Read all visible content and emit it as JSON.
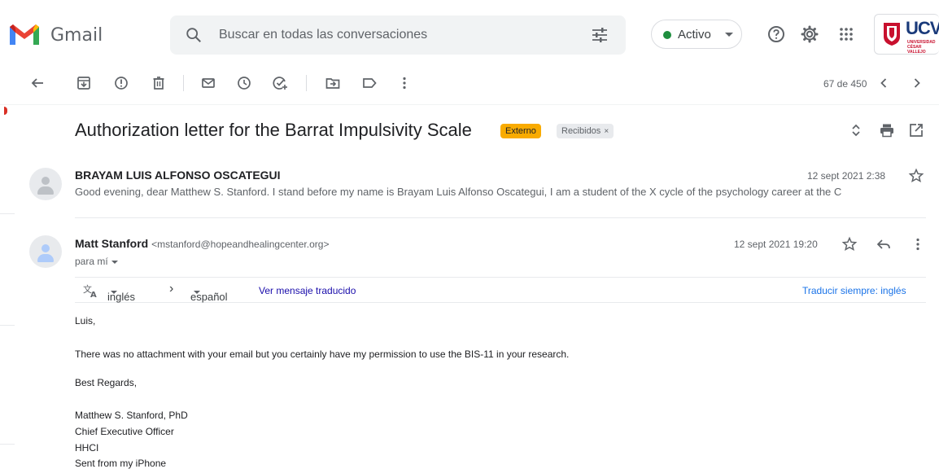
{
  "header": {
    "app_name": "Gmail",
    "search_placeholder": "Buscar en todas las conversaciones",
    "status_label": "Activo",
    "org_logo": {
      "text": "UCV",
      "subtitle_line1": "UNIVERSIDAD",
      "subtitle_line2": "CÉSAR VALLEJO"
    }
  },
  "toolbar": {
    "counter": "67 de 450"
  },
  "thread": {
    "subject": "Authorization letter for the Barrat Impulsivity Scale",
    "labels": [
      {
        "text": "Externo",
        "color": "#f9ab00"
      },
      {
        "text": "Recibidos",
        "color": "#e8eaed"
      }
    ],
    "label_close": "×"
  },
  "messages": [
    {
      "sender": "BRAYAM LUIS ALFONSO OSCATEGUI",
      "date": "12 sept 2021 2:38",
      "snippet": "Good evening, dear Matthew S. Stanford. I stand before my name is Brayam Luis Alfonso Oscategui, I am a student of the X cycle of the psychology career at the C"
    },
    {
      "sender": "Matt Stanford",
      "email": "<mstanford@hopeandhealingcenter.org>",
      "date": "12 sept 2021 19:20",
      "to": "para mí",
      "translate": {
        "from_lang": "inglés",
        "arrow": "›",
        "to_lang": "español",
        "view_link": "Ver mensaje traducido",
        "always_link": "Traducir siempre: inglés"
      },
      "body": {
        "greeting": "Luis,",
        "line1": "There was no attachment with your email but you certainly have my permission to use the BIS-11 in your research.",
        "closing": "Best Regards,",
        "sig1": "Matthew S. Stanford, PhD",
        "sig2": "Chief Executive Officer",
        "sig3": "HHCI",
        "sig4": "Sent from my iPhone"
      }
    }
  ],
  "colors": {
    "accent_blue": "#1a73e8",
    "link_blue": "#1a0dab",
    "status_green": "#1e8e3e",
    "ucv_red": "#c8102e",
    "ucv_blue": "#1a3a7a"
  }
}
